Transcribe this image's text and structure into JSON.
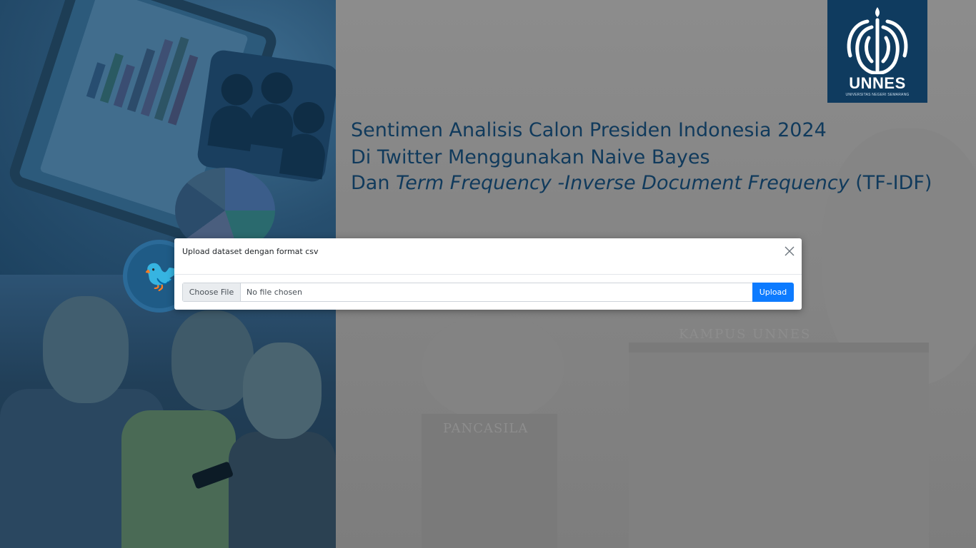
{
  "title": {
    "line1": "Sentimen Analisis Calon Presiden Indonesia 2024",
    "line2": "Di Twitter Menggunakan Naive Bayes",
    "line3_prefix": "Dan ",
    "line3_italic": "Term Frequency -Inverse Document Frequency",
    "line3_suffix": " (TF-IDF)"
  },
  "logo": {
    "name": "UNNES",
    "subtitle": "UNIVERSITAS NEGERI SEMARANG"
  },
  "background": {
    "monument_text": "PANCASILA",
    "building_text": "KAMPUS UNNES"
  },
  "modal": {
    "title": "Upload dataset dengan format csv",
    "choose_label": "Choose File",
    "file_status": "No file chosen",
    "upload_label": "Upload"
  },
  "colors": {
    "title": "#103a5c",
    "logo_bg": "#0f3b5f",
    "upload_button": "#0d7bff",
    "left_panel": "#1f4c6d"
  }
}
